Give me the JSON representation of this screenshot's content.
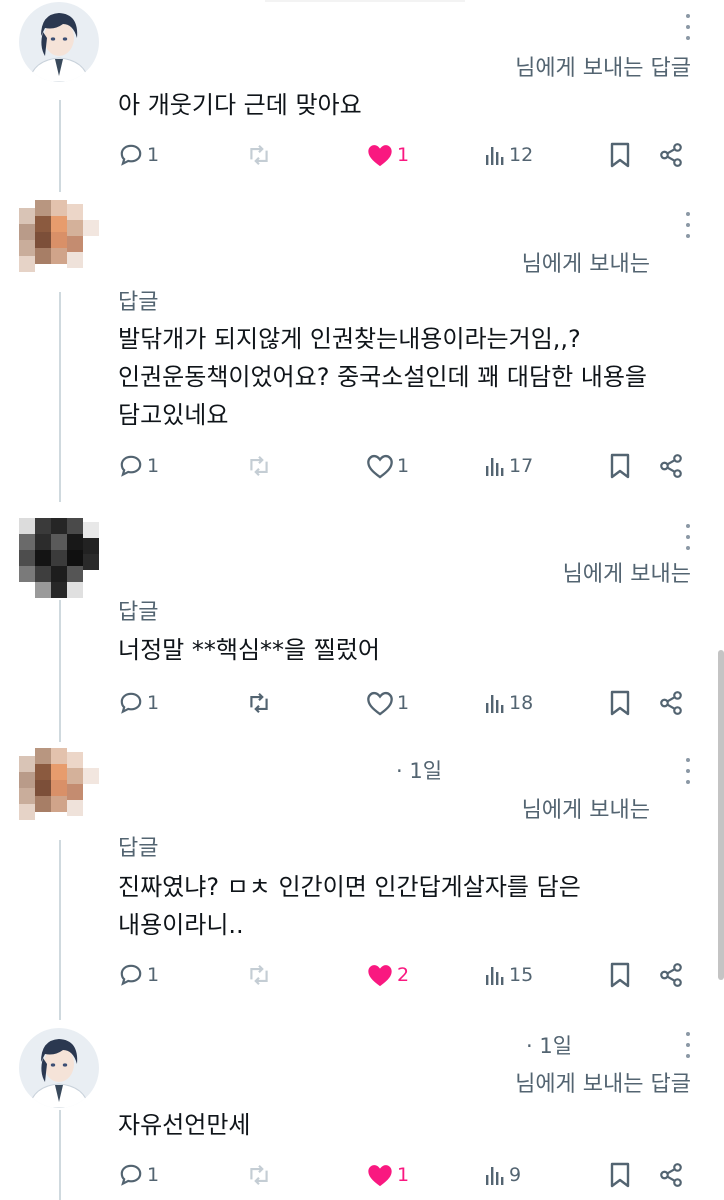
{
  "replies": [
    {
      "avatar": "anime-character-avatar",
      "time": "",
      "reply_to": "님에게 보내는 답글",
      "reply_to_line1": "",
      "reply_to_line2": "",
      "text_lines": [
        "아 개웃기다 근데 맞아요"
      ],
      "counts": {
        "reply": "1",
        "retweet": "",
        "like": "1",
        "views": "12"
      },
      "liked": true
    },
    {
      "avatar": "pixelated-avatar",
      "time": "",
      "reply_to": "",
      "reply_to_line1": "님에게 보내는",
      "reply_to_line2": "답글",
      "text_lines": [
        "발닦개가 되지않게 인권찾는내용이라는거임,,?",
        "인권운동책이었어요? 중국소설인데 꽤 대담한 내용을",
        "담고있네요"
      ],
      "counts": {
        "reply": "1",
        "retweet": "",
        "like": "1",
        "views": "17"
      },
      "liked": false
    },
    {
      "avatar": "pixelated-dark-avatar",
      "time": "",
      "reply_to": "",
      "reply_to_line1": "님에게 보내는",
      "reply_to_line2": "답글",
      "text_lines": [
        "너정말 **핵심**을 찔렀어"
      ],
      "counts": {
        "reply": "1",
        "retweet": "",
        "like": "1",
        "views": "18"
      },
      "liked": false
    },
    {
      "avatar": "pixelated-avatar",
      "time": "· 1일",
      "reply_to": "",
      "reply_to_line1": "님에게 보내는",
      "reply_to_line2": "답글",
      "text_lines": [
        "진짜였냐? ㅁㅊ 인간이면 인간답게살자를 담은",
        "내용이라니.."
      ],
      "counts": {
        "reply": "1",
        "retweet": "",
        "like": "2",
        "views": "15"
      },
      "liked": true
    },
    {
      "avatar": "anime-character-avatar",
      "time": "· 1일",
      "reply_to": "님에게 보내는 답글",
      "reply_to_line1": "",
      "reply_to_line2": "",
      "text_lines": [
        "자유선언만세"
      ],
      "counts": {
        "reply": "1",
        "retweet": "",
        "like": "1",
        "views": "9"
      },
      "liked": true
    }
  ],
  "icons": {
    "reply": "speech-bubble-icon",
    "retweet": "retweet-icon",
    "like": "heart-icon",
    "views": "views-bar-chart-icon",
    "bookmark": "bookmark-icon",
    "share": "share-icon",
    "more": "more-vertical-icon"
  },
  "colors": {
    "like_active": "#f91880",
    "muted": "#536471",
    "text": "#0f1419",
    "thread_line": "#cfd9de"
  }
}
